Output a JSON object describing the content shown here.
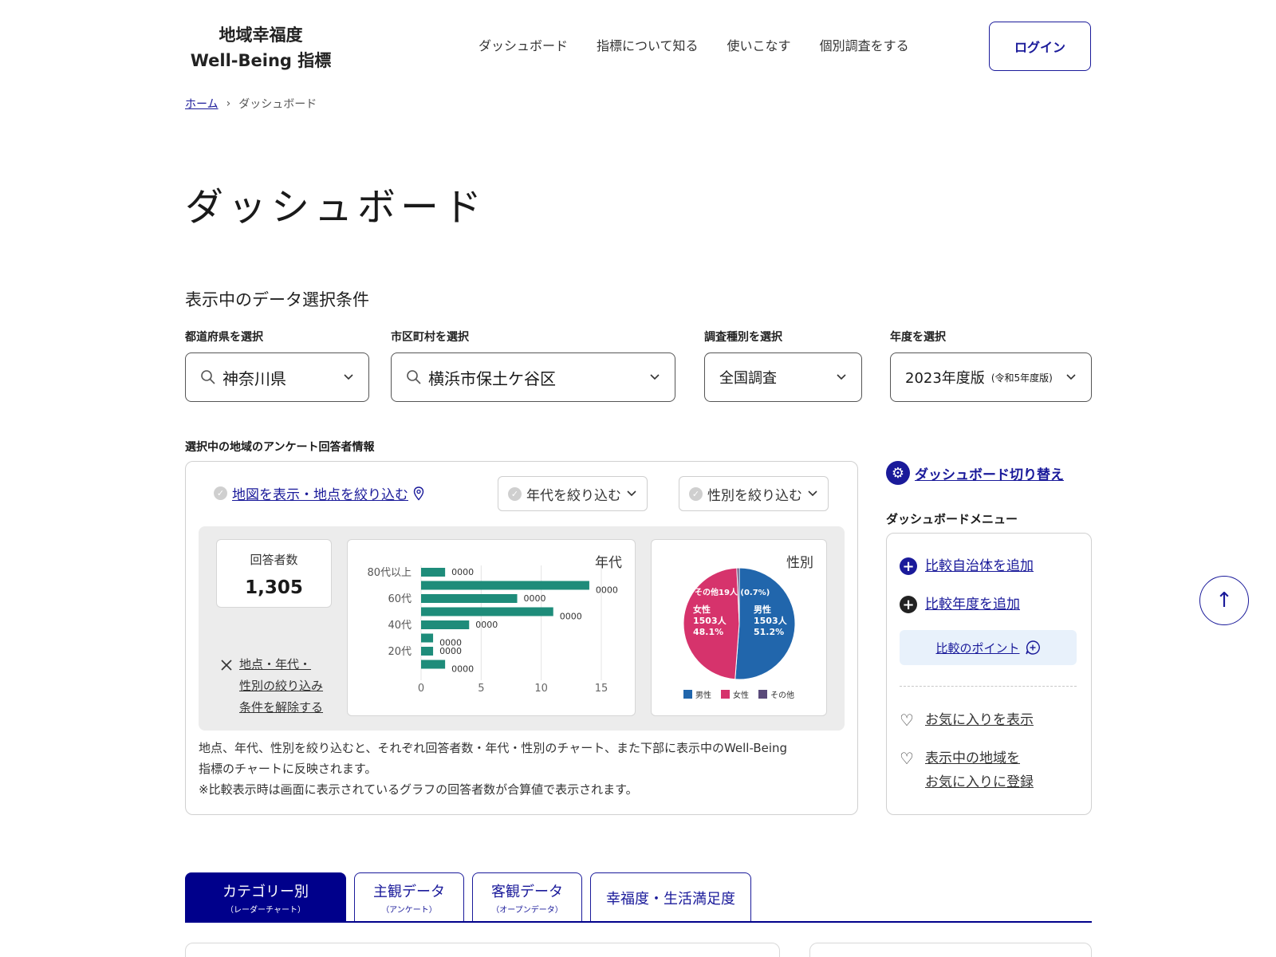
{
  "header": {
    "logo_line1": "地域幸福度",
    "logo_line2": "Well-Being 指標",
    "nav": [
      "ダッシュボード",
      "指標について知る",
      "使いこなす",
      "個別調査をする"
    ],
    "login": "ログイン"
  },
  "breadcrumb": {
    "home": "ホーム",
    "separator": "›",
    "current": "ダッシュボード"
  },
  "page_title": "ダッシュボード",
  "conditions": {
    "title": "表示中のデータ選択条件",
    "prefecture": {
      "label": "都道府県を選択",
      "value": "神奈川県"
    },
    "city": {
      "label": "市区町村を選択",
      "value": "横浜市保土ケ谷区"
    },
    "survey": {
      "label": "調査種別を選択",
      "value": "全国調査"
    },
    "year": {
      "label": "年度を選択",
      "value": "2023年度版",
      "sub": "(令和5年度版)"
    }
  },
  "respondents": {
    "title": "選択中の地域のアンケート回答者情報",
    "map_filter": "地図を表示・地点を絞り込む",
    "age_filter": "年代を絞り込む",
    "sex_filter": "性別を絞り込む",
    "count_label": "回答者数",
    "count_value": "1,305",
    "clear_line1": "地点・年代・",
    "clear_line2": "性別の絞り込み",
    "clear_line3": "条件を解除する",
    "note_line1": "地点、年代、性別を絞り込むと、それぞれ回答者数・年代・性別のチャート、また下部に表示中のWell-Being",
    "note_line2": "指標のチャートに反映されます。",
    "note_line3": "※比較表示時は画面に表示されているグラフの回答者数が合算値で表示されます。"
  },
  "chart_data": [
    {
      "type": "bar",
      "title": "年代",
      "orientation": "horizontal",
      "categories": [
        "80代以上",
        "",
        "60代",
        "",
        "40代",
        "",
        "20代",
        ""
      ],
      "values": [
        2,
        14,
        8,
        11,
        4,
        1,
        1,
        2
      ],
      "data_labels": [
        "0000",
        "0000",
        "0000",
        "0000",
        "0000",
        "0000",
        "0000",
        "0000"
      ],
      "xlim": [
        0,
        15
      ],
      "xticks": [
        0,
        5,
        10,
        15
      ],
      "color": "#1e8c7a",
      "grid": true
    },
    {
      "type": "pie",
      "title": "性別",
      "labels": [
        "男性",
        "女性",
        "その他"
      ],
      "values": [
        51.2,
        48.1,
        0.7
      ],
      "slice_labels": [
        {
          "name": "男性",
          "count": "1503人",
          "pct": "51.2%"
        },
        {
          "name": "女性",
          "count": "1503人",
          "pct": "48.1%"
        },
        {
          "name": "その他",
          "text": "その他19人 (0.7%)"
        }
      ],
      "colors": [
        "#2166ac",
        "#d6336c",
        "#5a4a7a"
      ],
      "legend": [
        "男性",
        "女性",
        "その他"
      ],
      "legend_position": "bottom"
    }
  ],
  "right_panel": {
    "switch": "ダッシュボード切り替え",
    "menu_title": "ダッシュボードメニュー",
    "add_municipality": "比較自治体を追加",
    "add_year": "比較年度を追加",
    "point": "比較のポイント",
    "show_favorites": "お気に入りを表示",
    "register_line1": "表示中の地域を",
    "register_line2": "お気に入りに登録"
  },
  "tabs": [
    {
      "main": "カテゴリー別",
      "sub": "（レーダーチャート）"
    },
    {
      "main": "主観データ",
      "sub": "（アンケート）"
    },
    {
      "main": "客観データ",
      "sub": "（オープンデータ）"
    },
    {
      "main": "幸福度・生活満足度",
      "sub": ""
    }
  ],
  "icons": {
    "search": "search-icon",
    "chevron": "chevron-down-icon",
    "gear": "gear-icon",
    "plus": "plus-circle-icon",
    "heart": "heart-icon",
    "arrow_up": "arrow-up-icon"
  },
  "colors": {
    "accent": "#1a1a9a",
    "tab_active": "#00008b"
  }
}
